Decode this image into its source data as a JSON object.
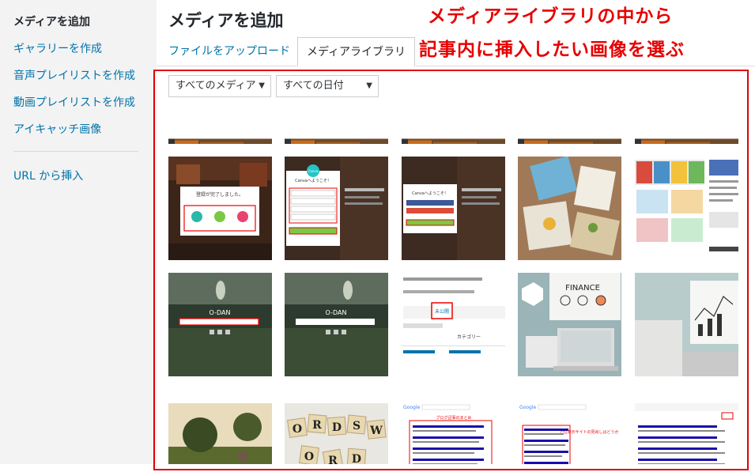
{
  "sidebar": {
    "items": [
      {
        "label": "メディアを追加",
        "active": true
      },
      {
        "label": "ギャラリーを作成",
        "active": false
      },
      {
        "label": "音声プレイリストを作成",
        "active": false
      },
      {
        "label": "動画プレイリストを作成",
        "active": false
      },
      {
        "label": "アイキャッチ画像",
        "active": false
      }
    ],
    "url_insert": "URL から挿入"
  },
  "header": {
    "title": "メディアを追加",
    "tabs": [
      {
        "label": "ファイルをアップロード"
      },
      {
        "label": "メディアライブラリ"
      }
    ]
  },
  "annotation": {
    "line1": "メディアライブラリの中から",
    "line2": "記事内に挿入したい画像を選ぶ",
    "color": "#e60000"
  },
  "filters": {
    "media_type": "すべてのメディア",
    "date": "すべての日付"
  },
  "thumbnails": {
    "canva_1_title": "登録が完了しました。",
    "canva_2_title": "Canvaへようこそ！",
    "canva_3_title": "Canvaへようこそ！",
    "canva_logo": "Canva",
    "ohdan_logo": "O-DAN",
    "finance_title": "FINANCE",
    "words_tiles": [
      "O",
      "R",
      "D",
      "S",
      "W",
      "O",
      "R",
      "D"
    ],
    "search_tab_label": "未公開",
    "category_label": "カテゴリー",
    "google_label": "Google",
    "annot_label_1": "ブログ記事のまとめ",
    "annot_label_2": "上位表示サイトの見出しはどうか"
  }
}
